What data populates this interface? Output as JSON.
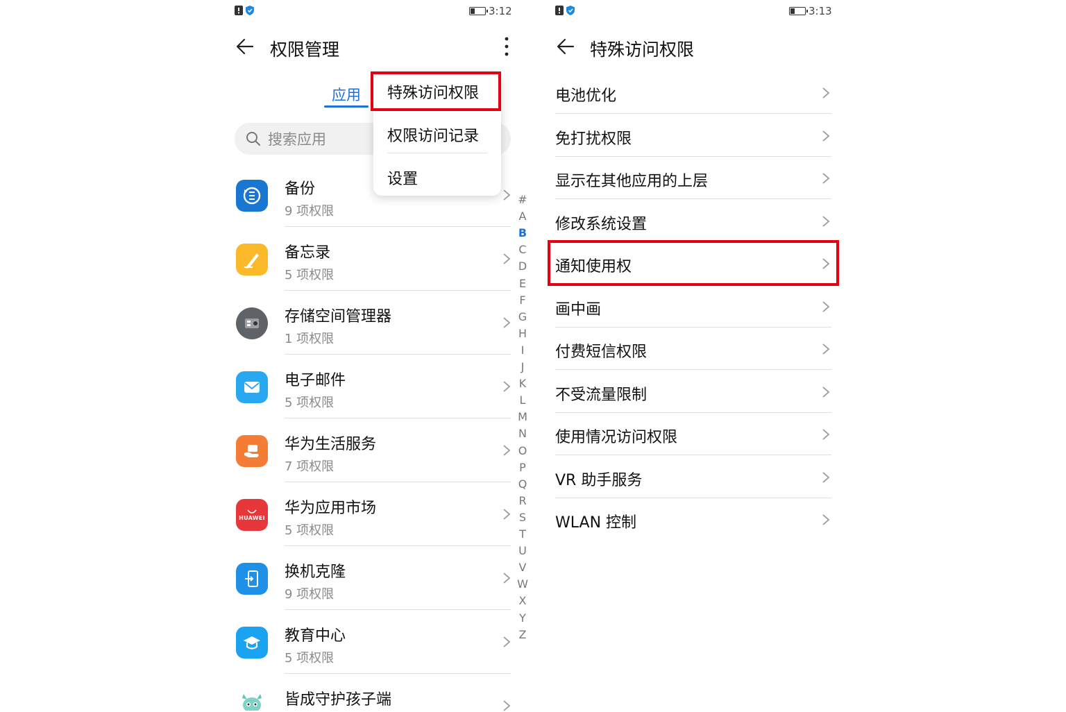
{
  "colors": {
    "accent": "#1e6fd9",
    "highlight": "#e60012",
    "divider": "#e0e0e0"
  },
  "left": {
    "status": {
      "time": "3:12"
    },
    "title": "权限管理",
    "tab_label": "应用",
    "search_placeholder": "搜索应用",
    "popup_items": [
      "特殊访问权限",
      "权限访问记录",
      "设置"
    ],
    "apps": [
      {
        "name": "备份",
        "sub": "9 项权限",
        "icon": "backup-icon"
      },
      {
        "name": "备忘录",
        "sub": "5 项权限",
        "icon": "notepad-icon"
      },
      {
        "name": "存储空间管理器",
        "sub": "1 项权限",
        "icon": "storage-manager-icon"
      },
      {
        "name": "电子邮件",
        "sub": "5 项权限",
        "icon": "email-icon"
      },
      {
        "name": "华为生活服务",
        "sub": "7 项权限",
        "icon": "life-service-icon"
      },
      {
        "name": "华为应用市场",
        "sub": "5 项权限",
        "icon": "app-market-icon"
      },
      {
        "name": "换机克隆",
        "sub": "9 项权限",
        "icon": "phone-clone-icon"
      },
      {
        "name": "教育中心",
        "sub": "5 项权限",
        "icon": "education-icon"
      },
      {
        "name": "皆成守护孩子端",
        "sub": "",
        "icon": "child-guard-icon"
      }
    ],
    "app_market_logo_text": "HUAWEI",
    "index_letters": [
      "#",
      "A",
      "B",
      "C",
      "D",
      "E",
      "F",
      "G",
      "H",
      "I",
      "J",
      "K",
      "L",
      "M",
      "N",
      "O",
      "P",
      "Q",
      "R",
      "S",
      "T",
      "U",
      "V",
      "W",
      "X",
      "Y",
      "Z"
    ],
    "index_active": "B"
  },
  "right": {
    "status": {
      "time": "3:13"
    },
    "title": "特殊访问权限",
    "items": [
      "电池优化",
      "免打扰权限",
      "显示在其他应用的上层",
      "修改系统设置",
      "通知使用权",
      "画中画",
      "付费短信权限",
      "不受流量限制",
      "使用情况访问权限",
      "VR 助手服务",
      "WLAN 控制"
    ],
    "highlighted": "通知使用权"
  }
}
